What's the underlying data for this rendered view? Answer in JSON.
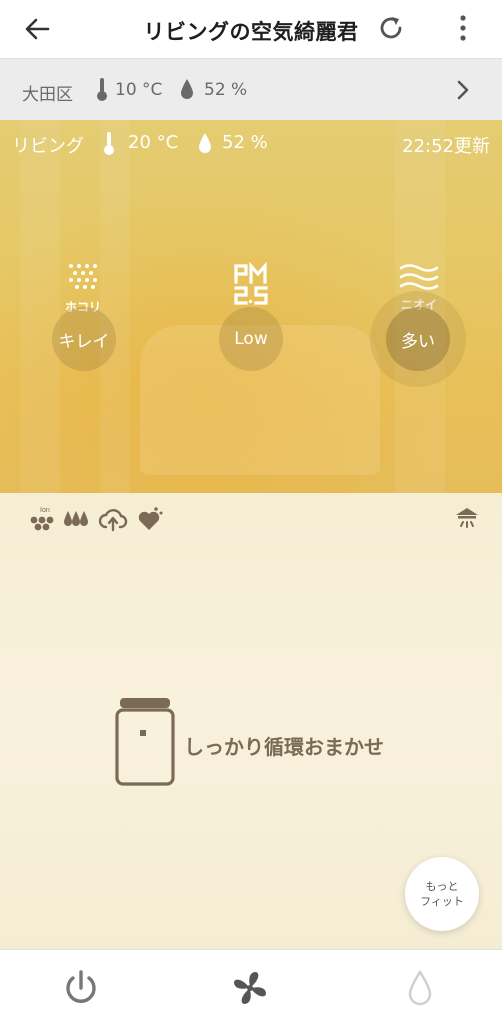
{
  "header": {
    "title": "リビングの空気綺麗君",
    "back_icon": "arrow-left-icon",
    "refresh_icon": "refresh-icon",
    "more_icon": "more-vertical-icon"
  },
  "outdoor": {
    "location": "大田区",
    "temperature": "10 °C",
    "humidity": "52 %",
    "chevron_icon": "chevron-right-icon"
  },
  "room": {
    "name": "リビング",
    "temperature": "20 °C",
    "humidity": "52 %",
    "updated": "22:52更新"
  },
  "sensors": {
    "dust": {
      "caption": "ホコリ",
      "value": "キレイ",
      "icon": "dust-dots-icon"
    },
    "pm25": {
      "caption": "PM 2.5",
      "value": "Low",
      "icon": "pm25-icon"
    },
    "odor": {
      "caption": "ニオイ",
      "value": "多い",
      "icon": "odor-waves-icon"
    }
  },
  "modes": {
    "ion_label": "Ion",
    "icons": [
      "ion-icon",
      "humidify-drops-icon",
      "cloud-upload-icon",
      "heart-sparkle-icon"
    ],
    "right_icon": "ceiling-light-icon"
  },
  "main": {
    "mode_label": "しっかり循環おまかせ",
    "fit_button_line1": "もっと",
    "fit_button_line2": "フィット"
  },
  "tabbar": {
    "power_icon": "power-icon",
    "fan_icon": "fan-icon",
    "water_icon": "water-drop-icon"
  },
  "colors": {
    "panel_yellow": "#e6c765",
    "cream": "#f6eed4",
    "brown": "#7b6a55",
    "outdoor_bar": "#ececec"
  }
}
